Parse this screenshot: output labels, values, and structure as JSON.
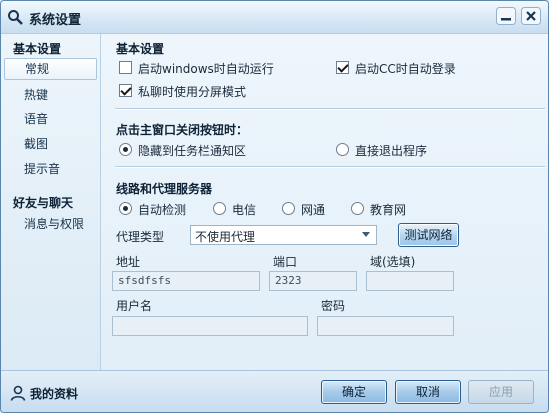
{
  "window": {
    "title": "系统设置"
  },
  "sidebar": {
    "groups": [
      {
        "title": "基本设置",
        "items": [
          "常规",
          "热键",
          "语音",
          "截图",
          "提示音"
        ]
      },
      {
        "title": "好友与聊天",
        "items": [
          "消息与权限"
        ]
      }
    ],
    "selected": "常规"
  },
  "basic": {
    "title": "基本设置",
    "auto_run": {
      "label": "启动windows时自动运行",
      "checked": false
    },
    "auto_login": {
      "label": "启动CC时自动登录",
      "checked": true
    },
    "split_screen": {
      "label": "私聊时使用分屏模式",
      "checked": true
    }
  },
  "close_behavior": {
    "title": "点击主窗口关闭按钮时：",
    "options": [
      "隐藏到任务栏通知区",
      "直接退出程序"
    ],
    "selected": "隐藏到任务栏通知区"
  },
  "network": {
    "title": "线路和代理服务器",
    "lines": [
      "自动检测",
      "电信",
      "网通",
      "教育网"
    ],
    "selected_line": "自动检测",
    "proxy_type_label": "代理类型",
    "proxy_type_value": "不使用代理",
    "test_button": "测试网络",
    "address_label": "地址",
    "address_value": "sfsdfsfs",
    "port_label": "端口",
    "port_value": "2323",
    "domain_label": "域(选填)",
    "domain_value": "",
    "username_label": "用户名",
    "username_value": "",
    "password_label": "密码",
    "password_value": ""
  },
  "footer": {
    "profile_label": "我的资料",
    "ok": "确定",
    "cancel": "取消",
    "apply": "应用"
  }
}
